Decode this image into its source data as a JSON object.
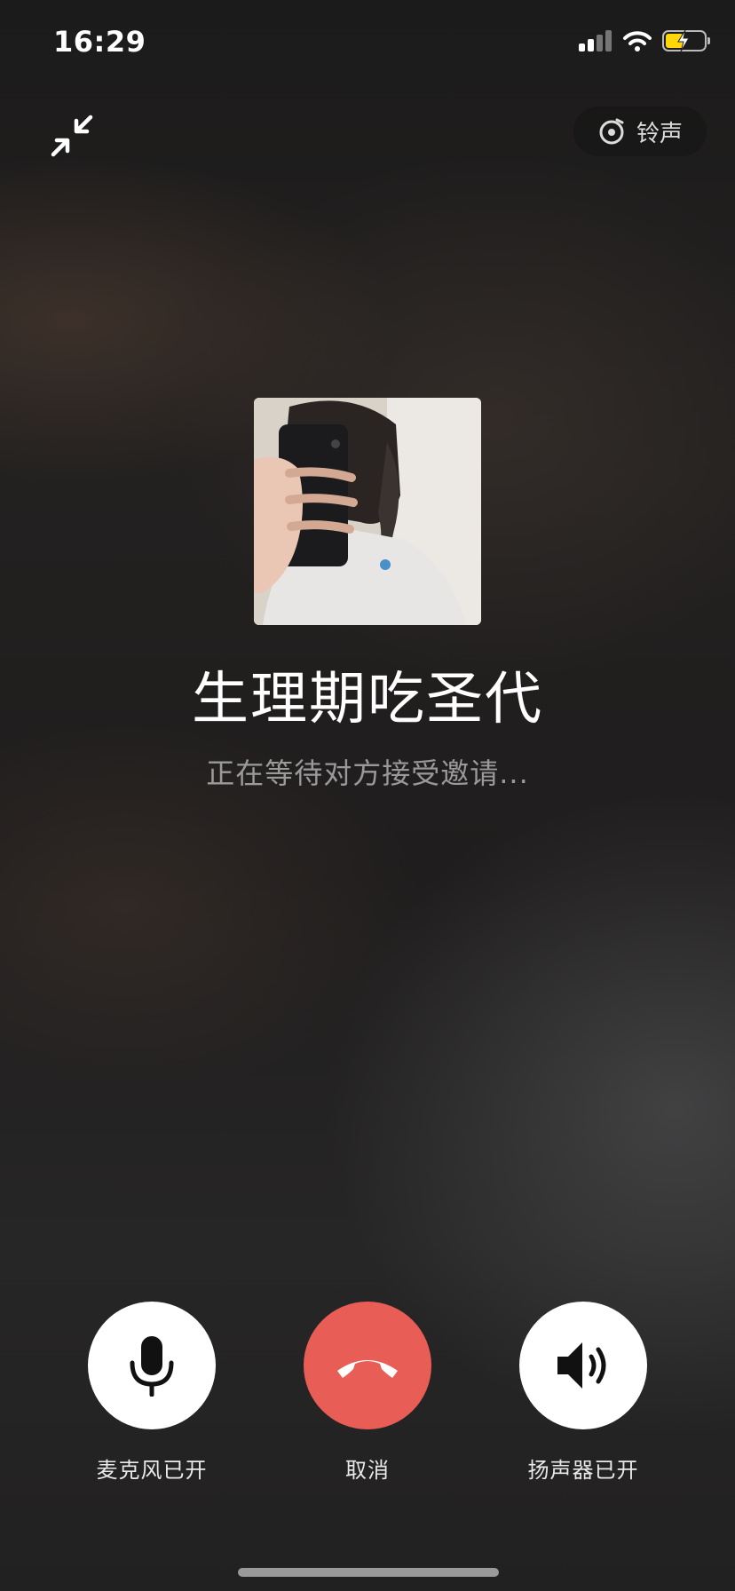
{
  "status_bar": {
    "time": "16:29",
    "battery_color": "#ffd60a"
  },
  "top": {
    "minimize_icon": "minimize-arrows-icon",
    "ringtone_label": "铃声"
  },
  "caller": {
    "name": "生理期吃圣代",
    "status": "正在等待对方接受邀请..."
  },
  "controls": [
    {
      "label": "麦克风已开",
      "icon": "microphone-icon"
    },
    {
      "label": "取消",
      "icon": "hang-up-icon",
      "color": "#e85d55"
    },
    {
      "label": "扬声器已开",
      "icon": "speaker-icon"
    }
  ]
}
